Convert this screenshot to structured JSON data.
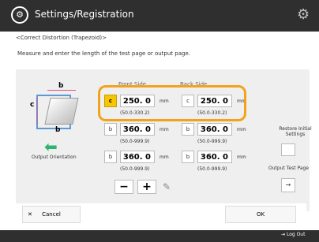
{
  "header": {
    "title": "Settings/Registration",
    "logo_icon": "settings-icon",
    "gear_icon": "gear-icon"
  },
  "breadcrumb": "<Correct Distortion (Trapezoid)>",
  "instruction": "Measure and enter the length of the test page or output page.",
  "diagram": {
    "label_b_top": "b",
    "label_c": "c",
    "label_b_bottom": "b",
    "arrow_icon": "arrow-left-icon",
    "output_orientation_label": "Output Orientation"
  },
  "columns": {
    "left_header": "Front Side",
    "right_header": "Back Side"
  },
  "rows": [
    {
      "left": {
        "letter": "c",
        "value": "250. 0",
        "unit": "mm",
        "range": "(50.0-330.2)"
      },
      "right": {
        "letter": "c",
        "value": "250. 0",
        "unit": "mm",
        "range": "(50.0-330.2)"
      }
    },
    {
      "left": {
        "letter": "b",
        "value": "360. 0",
        "unit": "mm",
        "range": "(50.0-999.9)"
      },
      "right": {
        "letter": "b",
        "value": "360. 0",
        "unit": "mm",
        "range": "(50.0-999.9)"
      }
    },
    {
      "left": {
        "letter": "b",
        "value": "360. 0",
        "unit": "mm",
        "range": "(50.0-999.9)"
      },
      "right": {
        "letter": "b",
        "value": "360. 0",
        "unit": "mm",
        "range": "(50.0-999.9)"
      }
    }
  ],
  "controls": {
    "minus": "−",
    "plus": "+",
    "pencil_icon": "pencil-icon"
  },
  "right_side": {
    "restore_label": "Restore Initial Settings",
    "output_test_label": "Output Test Page",
    "output_test_button": "→"
  },
  "footer": {
    "cancel": "Cancel",
    "ok": "OK",
    "logout": "Log Out"
  }
}
